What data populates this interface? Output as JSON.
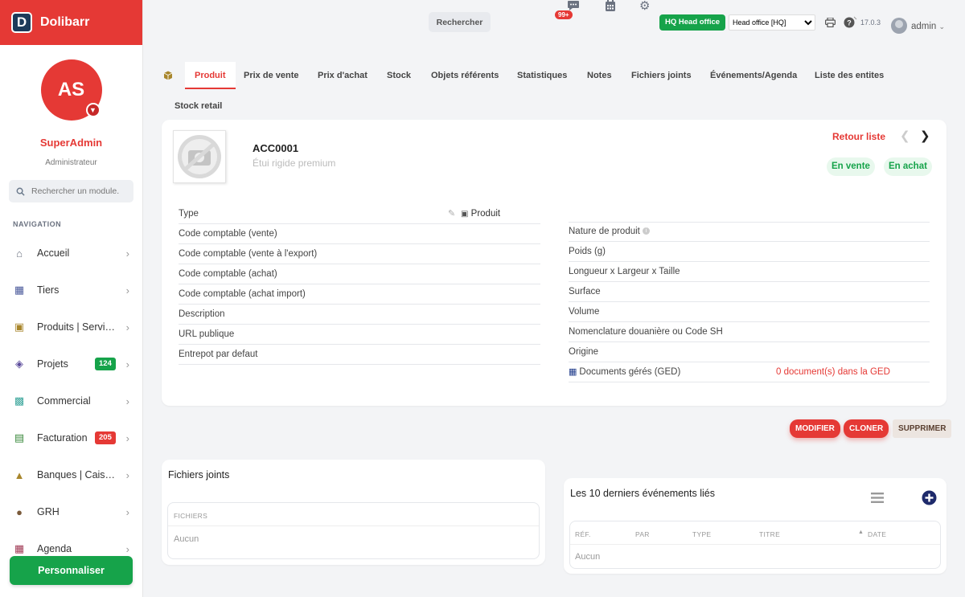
{
  "brand": {
    "name": "Dolibarr",
    "logo_letter": "D"
  },
  "user": {
    "initials": "AS",
    "name": "SuperAdmin",
    "role": "Administrateur",
    "top_name": "admin"
  },
  "sidebar": {
    "search_placeholder": "Rechercher un module.",
    "nav_heading": "NAVIGATION",
    "items": [
      {
        "label": "Accueil",
        "icon": "home-icon",
        "color": "#6b7280"
      },
      {
        "label": "Tiers",
        "icon": "building-icon",
        "color": "#4b5a9b"
      },
      {
        "label": "Produits | Services",
        "icon": "cube-icon",
        "color": "#a8862c"
      },
      {
        "label": "Projets",
        "icon": "sitemap-icon",
        "color": "#5b4b9b",
        "badge": "124",
        "badge_color": "#16a34a"
      },
      {
        "label": "Commercial",
        "icon": "briefcase-icon",
        "color": "#3aa59b"
      },
      {
        "label": "Facturation",
        "icon": "invoice-icon",
        "color": "#3b8a3e",
        "badge": "205",
        "badge_color": "#e53935"
      },
      {
        "label": "Banques | Caisses",
        "icon": "bank-icon",
        "color": "#a8862c"
      },
      {
        "label": "GRH",
        "icon": "user-tie-icon",
        "color": "#7a5a3a"
      },
      {
        "label": "Agenda",
        "icon": "calendar-icon",
        "color": "#a03a55"
      }
    ],
    "customize_label": "Personnaliser"
  },
  "topbar": {
    "search_label": "Rechercher",
    "notif_count": "99+",
    "entity_badge": "HQ Head office",
    "entity_select": "Head office [HQ]",
    "version": "17.0.3"
  },
  "tabs": [
    {
      "label": "Produit",
      "active": true
    },
    {
      "label": "Prix de vente"
    },
    {
      "label": "Prix d'achat"
    },
    {
      "label": "Stock"
    },
    {
      "label": "Objets référents"
    },
    {
      "label": "Statistiques"
    },
    {
      "label": "Notes"
    },
    {
      "label": "Fichiers joints"
    },
    {
      "label": "Événements/Agenda"
    },
    {
      "label": "Liste des entites"
    },
    {
      "label": "Stock retail"
    }
  ],
  "product": {
    "ref": "ACC0001",
    "label": "Étui rigide premium",
    "back_link": "Retour liste",
    "status_sell": "En vente",
    "status_buy": "En achat",
    "fields_left": [
      {
        "label": "Type",
        "value": "Produit"
      },
      {
        "label": "Code comptable (vente)",
        "value": ""
      },
      {
        "label": "Code comptable (vente à l'export)",
        "value": ""
      },
      {
        "label": "Code comptable (achat)",
        "value": ""
      },
      {
        "label": "Code comptable (achat import)",
        "value": ""
      },
      {
        "label": "Description",
        "value": ""
      },
      {
        "label": "URL publique",
        "value": ""
      },
      {
        "label": "Entrepot par defaut",
        "value": ""
      }
    ],
    "fields_right": [
      {
        "label": "Nature de produit",
        "value": ""
      },
      {
        "label": "Poids (g)",
        "value": ""
      },
      {
        "label": "Longueur x Largeur x Taille",
        "value": ""
      },
      {
        "label": "Surface",
        "value": ""
      },
      {
        "label": "Volume",
        "value": ""
      },
      {
        "label": "Nomenclature douanière ou Code SH",
        "value": ""
      },
      {
        "label": "Origine",
        "value": ""
      },
      {
        "label": "Documents gérés (GED)",
        "value": "0 document(s) dans la GED"
      }
    ]
  },
  "actions": {
    "modify": "MODIFIER",
    "clone": "CLONER",
    "delete": "SUPPRIMER"
  },
  "files": {
    "title": "Fichiers joints",
    "header": "FICHIERS",
    "empty": "Aucun"
  },
  "events": {
    "title": "Les 10 derniers événements liés",
    "columns": [
      "RÉF.",
      "PAR",
      "TYPE",
      "TITRE",
      "DATE"
    ],
    "empty": "Aucun"
  },
  "colors": {
    "accent": "#e53935",
    "success": "#16a34a"
  }
}
